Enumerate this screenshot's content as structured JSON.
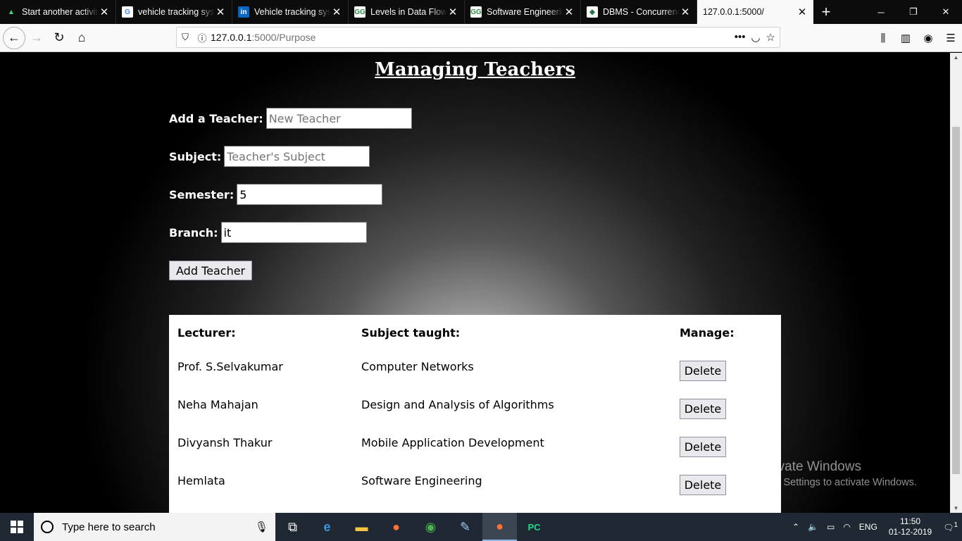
{
  "browser": {
    "tabs": [
      {
        "title": "Start another activit",
        "favicon": "android-icon",
        "active": false
      },
      {
        "title": "vehicle tracking syst",
        "favicon": "google-icon",
        "active": false
      },
      {
        "title": "Vehicle tracking syst",
        "favicon": "linkedin-icon",
        "active": false
      },
      {
        "title": "Levels in Data Flow D",
        "favicon": "geeksforgeeks-icon",
        "active": false
      },
      {
        "title": "Software Engineering",
        "favicon": "geeksforgeeks-icon",
        "active": false
      },
      {
        "title": "DBMS - Concurrency",
        "favicon": "tutorialspoint-icon",
        "active": false
      },
      {
        "title": "127.0.0.1:5000/",
        "favicon": "",
        "active": true
      }
    ],
    "url_host": "127.0.0.1",
    "url_path": ":5000/Purpose"
  },
  "page": {
    "title": "Managing Teachers",
    "form": {
      "teacher_label": "Add a Teacher:",
      "teacher_placeholder": "New Teacher",
      "subject_label": "Subject:",
      "subject_placeholder": "Teacher's Subject",
      "semester_label": "Semester:",
      "semester_value": "5",
      "branch_label": "Branch:",
      "branch_value": "it",
      "submit_label": "Add Teacher"
    },
    "table": {
      "headers": {
        "lecturer": "Lecturer:",
        "subject": "Subject taught:",
        "manage": "Manage:"
      },
      "delete_label": "Delete",
      "rows": [
        {
          "lecturer": "Prof. S.Selvakumar",
          "subject": "Computer Networks"
        },
        {
          "lecturer": "Neha Mahajan",
          "subject": "Design and Analysis of Algorithms"
        },
        {
          "lecturer": "Divyansh Thakur",
          "subject": "Mobile Application Development"
        },
        {
          "lecturer": "Hemlata",
          "subject": "Software Engineering"
        }
      ]
    }
  },
  "watermark": {
    "line1": "Activate Windows",
    "line2": "Go to Settings to activate Windows."
  },
  "taskbar": {
    "search_placeholder": "Type here to search",
    "language": "ENG",
    "time": "11:50",
    "date": "01-12-2019",
    "notification_count": "1"
  }
}
